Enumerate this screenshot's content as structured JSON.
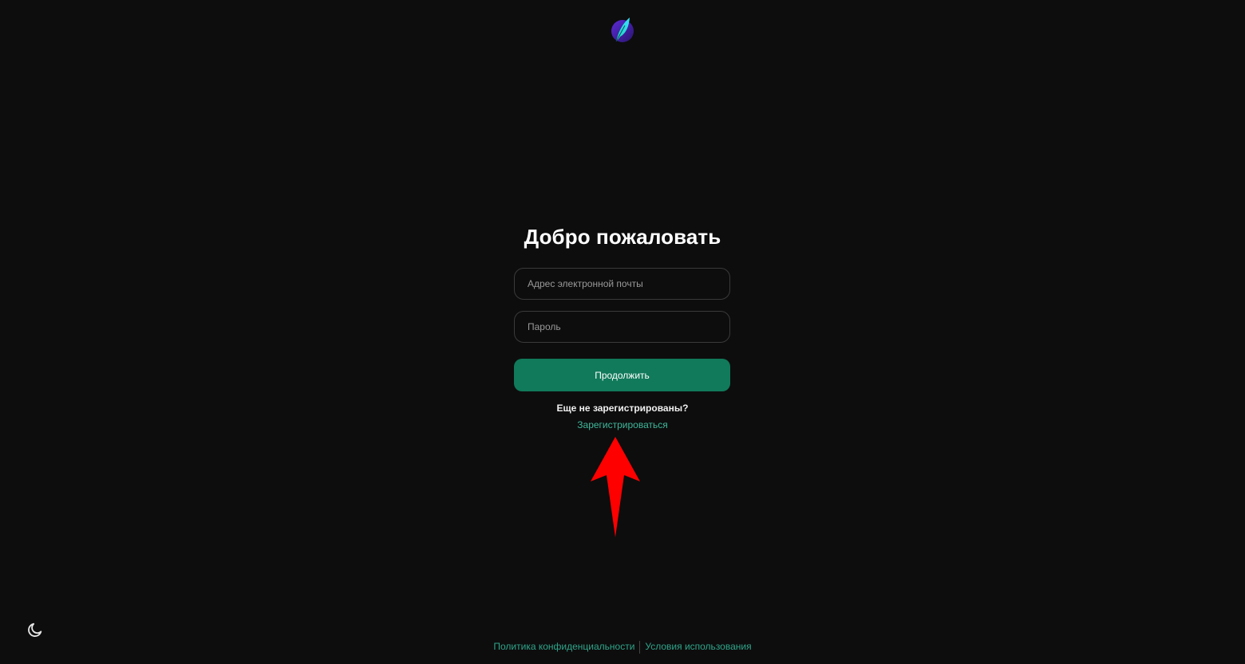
{
  "logo": {
    "icon": "feather-logo-icon"
  },
  "login": {
    "title": "Добро пожаловать",
    "email_placeholder": "Адрес электронной почты",
    "password_placeholder": "Пароль",
    "continue_label": "Продолжить",
    "not_registered_text": "Еще не зарегистрированы?",
    "register_label": "Зарегистрироваться"
  },
  "annotation": {
    "icon": "red-arrow-up-icon",
    "color": "#ff0000"
  },
  "theme_toggle": {
    "icon": "moon-icon"
  },
  "footer": {
    "privacy_label": "Политика конфиденциальности",
    "terms_label": "Условия использования"
  },
  "colors": {
    "background": "#0d0d0d",
    "accent": "#107a5a",
    "link": "#3fb79a"
  }
}
